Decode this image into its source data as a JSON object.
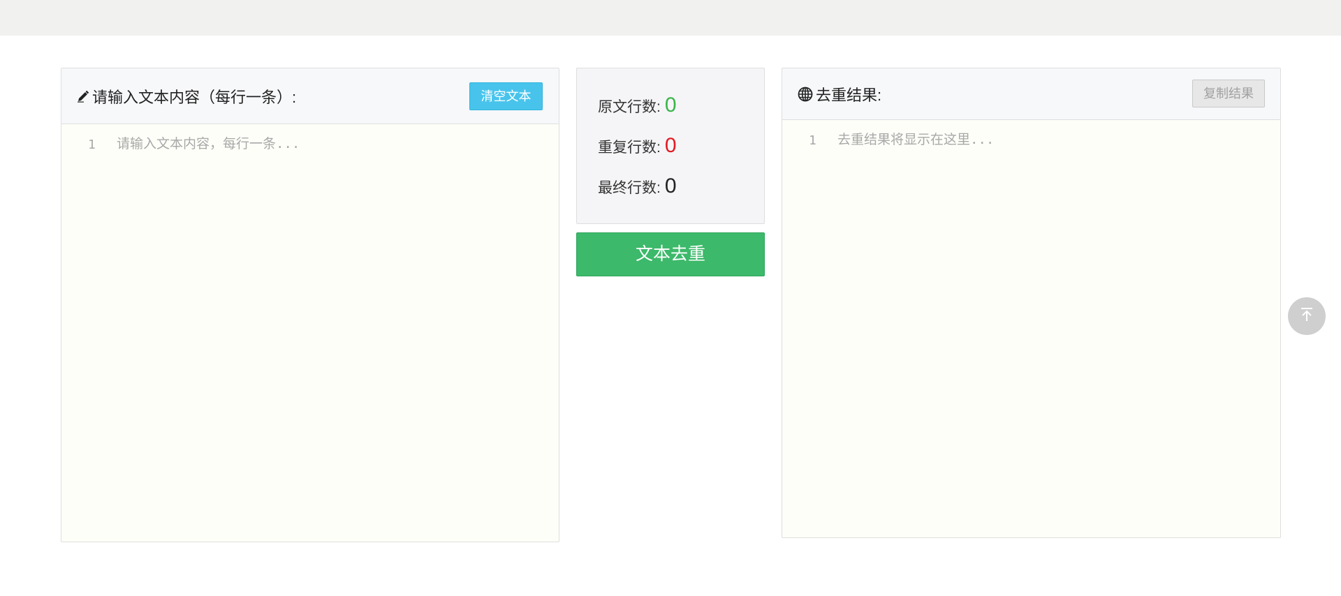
{
  "input_panel": {
    "title": "请输入文本内容（每行一条）:",
    "clear_button": "清空文本",
    "line_number": "1",
    "placeholder": "请输入文本内容，每行一条..."
  },
  "stats": {
    "original_label": "原文行数:",
    "original_value": "0",
    "duplicate_label": "重复行数:",
    "duplicate_value": "0",
    "final_label": "最终行数:",
    "final_value": "0"
  },
  "dedupe_button": "文本去重",
  "output_panel": {
    "title": "去重结果:",
    "copy_button": "复制结果",
    "line_number": "1",
    "placeholder": "去重结果将显示在这里..."
  },
  "icons": {
    "input_title_icon": "pencil-icon",
    "output_title_icon": "globe-icon",
    "back_to_top_icon": "arrow-up-to-line-icon"
  },
  "colors": {
    "clear_button": "#48c4ec",
    "dedupe_button": "#3cb96a",
    "original_value": "#39b54a",
    "duplicate_value": "#e21a23",
    "final_value": "#222222"
  }
}
